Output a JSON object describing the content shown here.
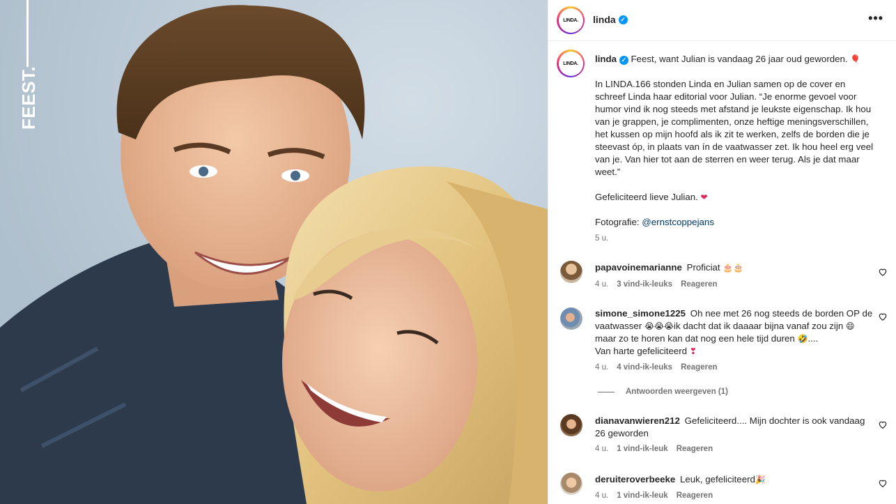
{
  "photo": {
    "overlay_text": "FEEST."
  },
  "header": {
    "username": "linda",
    "avatar_text": "LINDA.",
    "more_icon": "more-options-icon"
  },
  "caption": {
    "username": "linda",
    "avatar_text": "LINDA.",
    "first_line": "Feest, want Julian is vandaag 26 jaar oud geworden.",
    "first_line_emoji": "🎈",
    "paragraph": "In LINDA.166 stonden Linda en Julian samen op de cover en schreef Linda haar editorial voor Julian. “Je enorme gevoel voor humor vind ik nog steeds met afstand je leukste eigenschap. Ik hou van je grappen, je complimenten, onze heftige meningsverschillen, het kussen op mijn hoofd als ik zit te werken, zelfs de borden die je steevast óp, in plaats van ín de vaatwasser zet. Ik hou heel erg veel van je. Van hier tot aan de sterren en weer terug. Als je dat maar weet.”",
    "congrats": "Gefeliciteerd lieve Julian.",
    "congrats_emoji": "❤",
    "photo_credit_label": "Fotografie:",
    "photo_credit_handle": "@ernstcoppejans",
    "time": "5 u."
  },
  "comments": [
    {
      "username": "papavoinemarianne",
      "text": "Proficiat",
      "emoji": "🎂🎂",
      "time": "4 u.",
      "likes": "3 vind-ik-leuks",
      "reply": "Reageren"
    },
    {
      "username": "simone_simone1225",
      "text_a": "Oh nee met 26 nog steeds de borden OP de vaatwasser",
      "emoji_a": "😭😭😭",
      "text_b": "ik dacht dat ik daaaar bijna vanaf zou zijn",
      "emoji_b": "😄",
      "text_c": "maar zo te horen kan dat nog een hele tijd duren",
      "emoji_c": "🤣",
      "text_d": "....",
      "text_e": "Van harte gefeliciteerd",
      "emoji_e": "❣",
      "time": "4 u.",
      "likes": "4 vind-ik-leuks",
      "reply": "Reageren",
      "replies_label": "Antwoorden weergeven (1)"
    },
    {
      "username": "dianavanwieren212",
      "text": "Gefeliciteerd.... Mijn dochter is ook vandaag 26 geworden",
      "time": "4 u.",
      "likes": "1 vind-ik-leuk",
      "reply": "Reageren"
    },
    {
      "username": "deruiteroverbeeke",
      "text": "Leuk, gefeliciteerd",
      "emoji": "🎉",
      "time": "4 u.",
      "likes": "1 vind-ik-leuk",
      "reply": "Reageren"
    }
  ],
  "colors": {
    "verified": "#0095f6",
    "link": "#00376b",
    "muted": "#737373",
    "heart_red": "#e0245e"
  }
}
